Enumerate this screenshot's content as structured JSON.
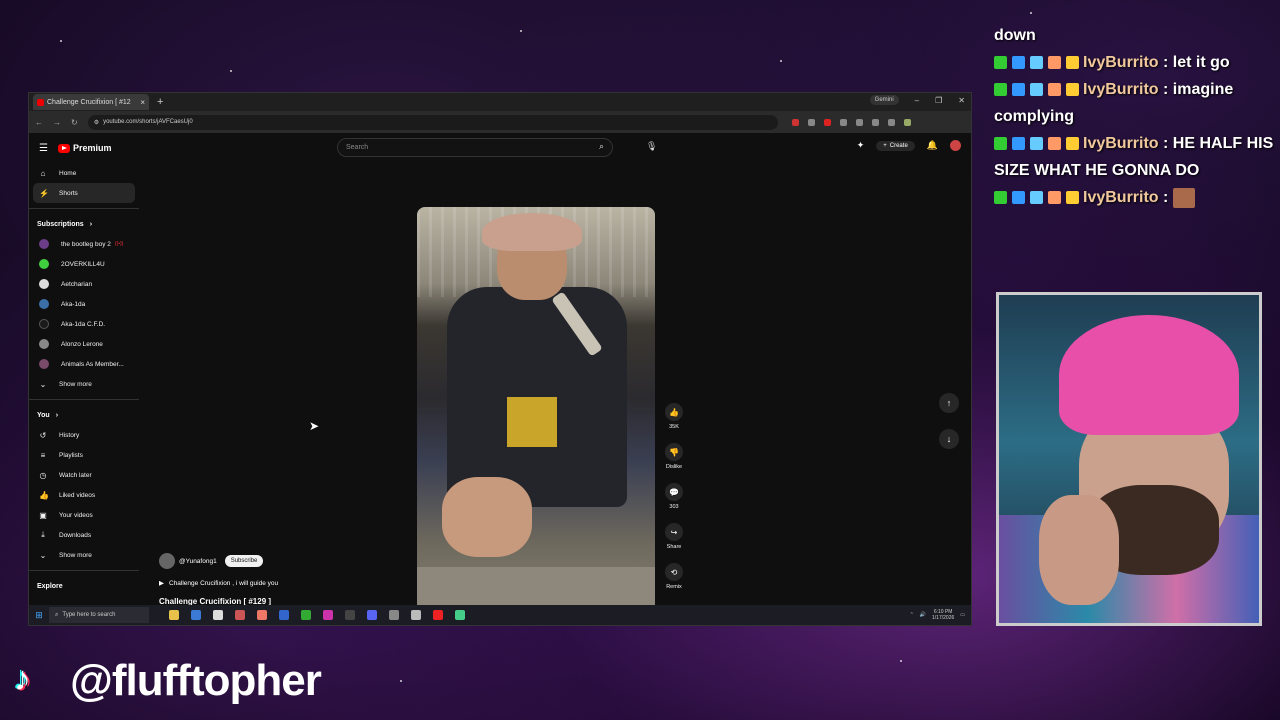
{
  "browser": {
    "tab_title": "Challenge Crucifixion [ #12",
    "url": "youtube.com/shorts/jAVFCaesUj0",
    "gemini_label": "Gemini"
  },
  "youtube": {
    "logo_text": "Premium",
    "search_placeholder": "Search",
    "create_label": "Create",
    "nav": [
      {
        "label": "Home",
        "icon": "home-icon"
      },
      {
        "label": "Shorts",
        "icon": "shorts-icon"
      }
    ],
    "subscriptions_heading": "Subscriptions",
    "subscriptions": [
      {
        "label": "the bootleg boy 2",
        "color": "#6b3d8a"
      },
      {
        "label": "2OVERKILL4U",
        "color": "#3fcf3f"
      },
      {
        "label": "Aetcharian",
        "color": "#dddddd"
      },
      {
        "label": "Aka-1da",
        "color": "#3a6fa8"
      },
      {
        "label": "Aka-1da C.F.D.",
        "color": "#1a1a1a"
      },
      {
        "label": "Alonzo Lerone",
        "color": "#888888"
      },
      {
        "label": "Animals As Member...",
        "color": "#7a4a6a"
      }
    ],
    "show_more": "Show more",
    "you_heading": "You",
    "you_items": [
      {
        "label": "History",
        "icon": "history-icon"
      },
      {
        "label": "Playlists",
        "icon": "playlists-icon"
      },
      {
        "label": "Watch later",
        "icon": "watch-later-icon"
      },
      {
        "label": "Liked videos",
        "icon": "liked-icon"
      },
      {
        "label": "Your videos",
        "icon": "your-videos-icon"
      },
      {
        "label": "Downloads",
        "icon": "downloads-icon"
      }
    ],
    "show_more_2": "Show more",
    "explore_heading": "Explore",
    "short": {
      "channel": "@Yunafong1",
      "subscribe_label": "Subscribe",
      "description": "Challenge Crucifixion , i will guide you",
      "title": "Challenge Crucifixion [ #129 ]",
      "likes": "35K",
      "dislike_label": "Dislike",
      "comments": "303",
      "share_label": "Share",
      "remix_label": "Remix",
      "progress": 0.18
    }
  },
  "taskbar": {
    "search_placeholder": "Type here to search",
    "time": "6:10 PM",
    "date": "1/17/2026"
  },
  "chat": {
    "lines": [
      {
        "user": "",
        "text": "down"
      },
      {
        "user": "IvyBurrito",
        "text": " : let it go"
      },
      {
        "user": "IvyBurrito",
        "text": " : imagine complying"
      },
      {
        "user": "IvyBurrito",
        "text": " : HE HALF HIS SIZE WHAT HE GONNA DO"
      },
      {
        "user": "IvyBurrito",
        "text": " : "
      }
    ]
  },
  "streamer_handle": "@flufftopher"
}
